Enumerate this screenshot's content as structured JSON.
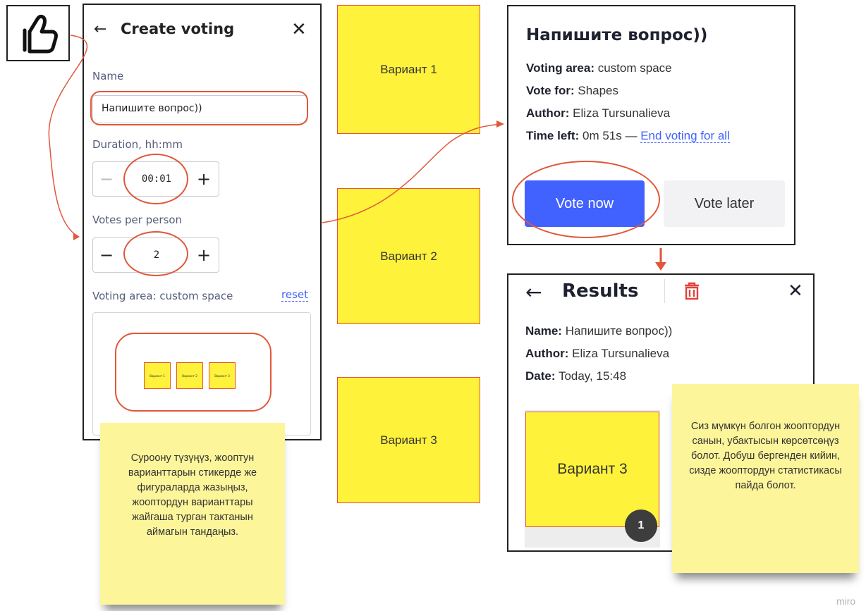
{
  "create_panel": {
    "title": "Create voting",
    "name_label": "Name",
    "name_value": "Напишите вопрос))",
    "duration_label": "Duration, hh:mm",
    "duration_value": "00:01",
    "votes_label": "Votes per person",
    "votes_value": "2",
    "area_label": "Voting area: custom space",
    "reset_label": "reset",
    "mini_stickies": [
      "Вариант 1",
      "Вариант 2",
      "Вариант 3"
    ]
  },
  "stickies": [
    "Вариант 1",
    "Вариант 2",
    "Вариант 3"
  ],
  "vote_card": {
    "question": "Напишите вопрос))",
    "area_key": "Voting area:",
    "area_value": "custom space",
    "vote_for_key": "Vote for:",
    "vote_for_value": "Shapes",
    "author_key": "Author:",
    "author_value": "Eliza Tursunalieva",
    "time_key": "Time left:",
    "time_value": "0m 51s —",
    "end_link": "End voting for all",
    "vote_now": "Vote now",
    "vote_later": "Vote later"
  },
  "results_card": {
    "title": "Results",
    "name_key": "Name:",
    "name_value": "Напишите вопрос))",
    "author_key": "Author:",
    "author_value": "Eliza Tursunalieva",
    "date_key": "Date:",
    "date_value": "Today, 15:48",
    "sticky_label": "Вариант 3",
    "vote_count": "1"
  },
  "notes": {
    "left": "Суроону түзүңүз, жооптун варианттарын  стикерде же фигураларда жазыңыз, жооптордун варианттары жайгаша турган тактанын аймагын тандаңыз.",
    "right": "Сиз мүмкүн болгон жооптордун санын, убактысын көрсөтсөңүз болот. Добуш бергенден кийин, сизде жооптордун статистикасы пайда болот."
  },
  "watermark": "miro",
  "colors": {
    "accent": "#4262ff",
    "annotation": "#e0573a",
    "sticky": "#fff23a",
    "note": "#fdf59a",
    "delete": "#e0433a"
  }
}
